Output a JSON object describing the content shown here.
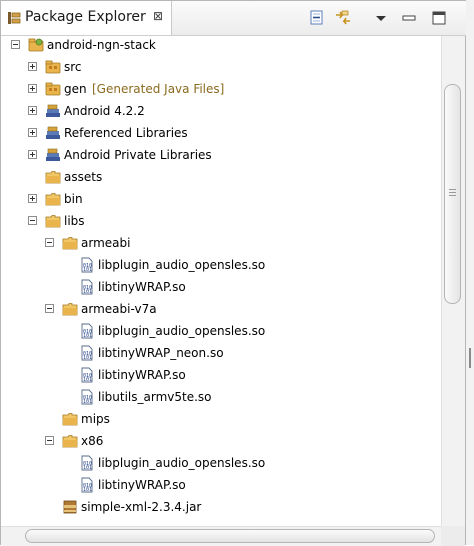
{
  "view": {
    "title": "Package Explorer",
    "close_glyph": "⊠",
    "toolbar": [
      "collapse-all-icon",
      "link-with-editor-icon",
      "view-menu-icon",
      "minimize-icon",
      "maximize-icon"
    ]
  },
  "colors": {
    "folder": "#e9b44c",
    "package": "#d2a04a",
    "library": "#3c5a9b",
    "decoration": "#8b6a1e",
    "selection": "#ffffff"
  },
  "tree": [
    {
      "label": "android-ngn-stack",
      "icon": "project-icon",
      "state": "expanded"
    },
    {
      "label": "src",
      "icon": "source-folder-icon",
      "state": "collapsed"
    },
    {
      "label": "gen",
      "decoration": "[Generated Java Files]",
      "icon": "source-folder-icon",
      "state": "collapsed"
    },
    {
      "label": "Android 4.2.2",
      "icon": "library-icon",
      "state": "collapsed"
    },
    {
      "label": "Referenced Libraries",
      "icon": "library-icon",
      "state": "collapsed"
    },
    {
      "label": "Android Private Libraries",
      "icon": "library-icon",
      "state": "collapsed"
    },
    {
      "label": "assets",
      "icon": "folder-icon",
      "state": "none"
    },
    {
      "label": "bin",
      "icon": "folder-icon",
      "state": "collapsed"
    },
    {
      "label": "libs",
      "icon": "folder-icon",
      "state": "expanded"
    },
    {
      "label": "armeabi",
      "icon": "folder-icon",
      "state": "expanded"
    },
    {
      "label": "libplugin_audio_opensles.so",
      "icon": "binary-file-icon",
      "state": "none"
    },
    {
      "label": "libtinyWRAP.so",
      "icon": "binary-file-icon",
      "state": "none"
    },
    {
      "label": "armeabi-v7a",
      "icon": "folder-icon",
      "state": "expanded"
    },
    {
      "label": "libplugin_audio_opensles.so",
      "icon": "binary-file-icon",
      "state": "none"
    },
    {
      "label": "libtinyWRAP_neon.so",
      "icon": "binary-file-icon",
      "state": "none"
    },
    {
      "label": "libtinyWRAP.so",
      "icon": "binary-file-icon",
      "state": "none"
    },
    {
      "label": "libutils_armv5te.so",
      "icon": "binary-file-icon",
      "state": "none"
    },
    {
      "label": "mips",
      "icon": "folder-icon",
      "state": "none"
    },
    {
      "label": "x86",
      "icon": "folder-icon",
      "state": "expanded"
    },
    {
      "label": "libplugin_audio_opensles.so",
      "icon": "binary-file-icon",
      "state": "none"
    },
    {
      "label": "libtinyWRAP.so",
      "icon": "binary-file-icon",
      "state": "none"
    },
    {
      "label": "simple-xml-2.3.4.jar",
      "icon": "jar-icon",
      "state": "none"
    }
  ]
}
